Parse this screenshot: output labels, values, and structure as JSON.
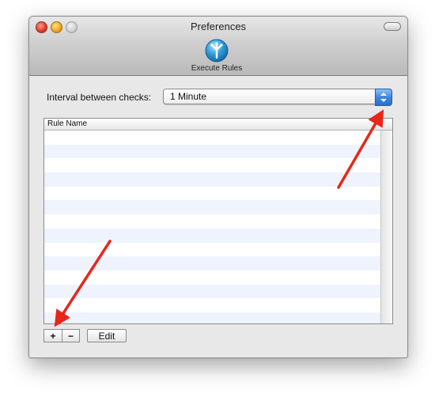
{
  "window": {
    "title": "Preferences"
  },
  "toolbar": {
    "items": [
      {
        "label": "Execute Rules",
        "icon": "execute-rules-icon"
      }
    ]
  },
  "interval": {
    "label": "Interval between checks:",
    "selected": "1 Minute"
  },
  "table": {
    "columns": [
      "Rule Name"
    ],
    "rows": []
  },
  "buttons": {
    "add_label": "+",
    "remove_label": "−",
    "edit_label": "Edit"
  },
  "annotations": {
    "arrow_color": "#e8261a",
    "arrows": [
      "points-to-interval-dropdown",
      "points-to-add-button"
    ]
  },
  "colors": {
    "select_accent": "#3d86de",
    "row_alt": "#eef3fd"
  }
}
